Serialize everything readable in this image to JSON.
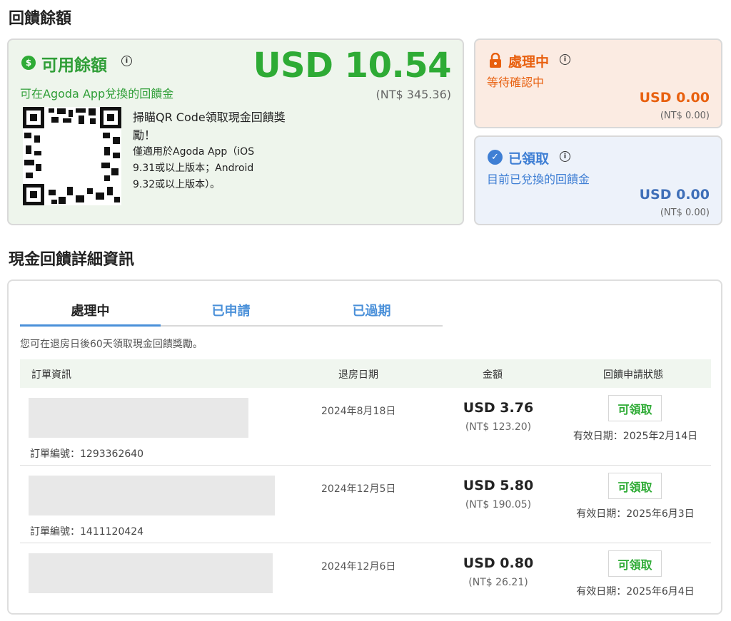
{
  "section_titles": {
    "balance": "回饋餘額",
    "details": "現金回饋詳細資訊"
  },
  "available": {
    "title": "可用餘額",
    "subtitle": "可在Agoda App兌換的回饋金",
    "amount": "USD 10.54",
    "local_amount": "(NT$ 345.36)",
    "qr_main_text": "掃瞄QR Code領取現金回饋獎勵！",
    "qr_note": "僅適用於Agoda App（iOS 9.31或以上版本；Android 9.32或以上版本）。",
    "color": "#2eab35"
  },
  "pending": {
    "title": "處理中",
    "subtitle": "等待確認中",
    "amount": "USD 0.00",
    "local_amount": "(NT$ 0.00)",
    "color": "#e8600f"
  },
  "claimed": {
    "title": "已領取",
    "subtitle": "目前已兌換的回饋金",
    "amount": "USD 0.00",
    "local_amount": "(NT$ 0.00)",
    "color": "#3f7fd4"
  },
  "tabs": [
    {
      "label": "處理中",
      "active": true
    },
    {
      "label": "已申請",
      "active": false
    },
    {
      "label": "已過期",
      "active": false
    }
  ],
  "notice": "您可在退房日後60天領取現金回饋獎勵。",
  "table": {
    "headers": {
      "order": "訂單資訊",
      "checkout": "退房日期",
      "amount": "金額",
      "status": "回饋申請狀態"
    },
    "rows": [
      {
        "order_no": "訂單編號：1293362640",
        "checkout": "2024年8月18日",
        "amount": "USD 3.76",
        "local": "(NT$ 123.20)",
        "button": "可領取",
        "expiry": "有效日期：2025年2月14日"
      },
      {
        "order_no": "訂單編號：1411120424",
        "checkout": "2024年12月5日",
        "amount": "USD 5.80",
        "local": "(NT$ 190.05)",
        "button": "可領取",
        "expiry": "有效日期：2025年6月3日"
      },
      {
        "order_no": "",
        "checkout": "2024年12月6日",
        "amount": "USD 0.80",
        "local": "(NT$ 26.21)",
        "button": "可領取",
        "expiry": "有效日期：2025年6月4日"
      }
    ]
  },
  "icons": {
    "available": "cash-hand-icon",
    "pending": "lock-icon",
    "claimed": "check-circle-icon",
    "info": "info-icon"
  }
}
